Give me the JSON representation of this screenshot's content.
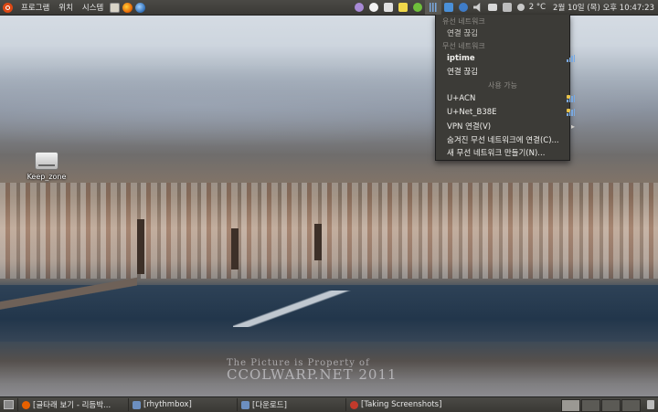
{
  "top_panel": {
    "menus": [
      "프로그램",
      "위치",
      "시스템"
    ],
    "launchers": [
      "home-folder-icon",
      "firefox-icon",
      "network-app-icon"
    ],
    "tray": {
      "temperature": "2 °C",
      "clock": "2월 10일 (목) 오후 10:47:23"
    }
  },
  "desktop": {
    "icons": [
      {
        "label": "Keep_zone",
        "icon": "drive-icon"
      }
    ]
  },
  "network_menu": {
    "wired_header": "유선 네트워크",
    "wired_status": "연결 끊김",
    "wireless_header": "무선 네트워크",
    "connected_network": "iptime",
    "disconnect": "연결 끊김",
    "available_header": "사용 가능",
    "available": [
      "U+ACN",
      "U+Net_B38E"
    ],
    "vpn": "VPN 연결(V)",
    "connect_hidden": "숨겨진 무선 네트워크에 연결(C)...",
    "create_new": "새 무선 네트워크 만들기(N)..."
  },
  "taskbar": {
    "tasks": [
      {
        "label": "[글타래 보기 - 리듬박...",
        "icon": "firefox-icon",
        "color": "#e66000"
      },
      {
        "label": "[rhythmbox]",
        "icon": "folder-icon",
        "color": "#6c8fc0"
      },
      {
        "label": "[다운로드]",
        "icon": "folder-icon",
        "color": "#6c8fc0"
      },
      {
        "label": "[Taking Screenshots]",
        "icon": "help-icon",
        "color": "#c23a2b"
      }
    ]
  },
  "wallpaper": {
    "watermark_line1": "The Picture is Property of",
    "watermark_line2": "CCOLWARP.NET 2011"
  },
  "colors": {
    "panel": "#3c3b37",
    "accent_ubuntu": "#dd4814",
    "signal": "#7aa9e0"
  }
}
